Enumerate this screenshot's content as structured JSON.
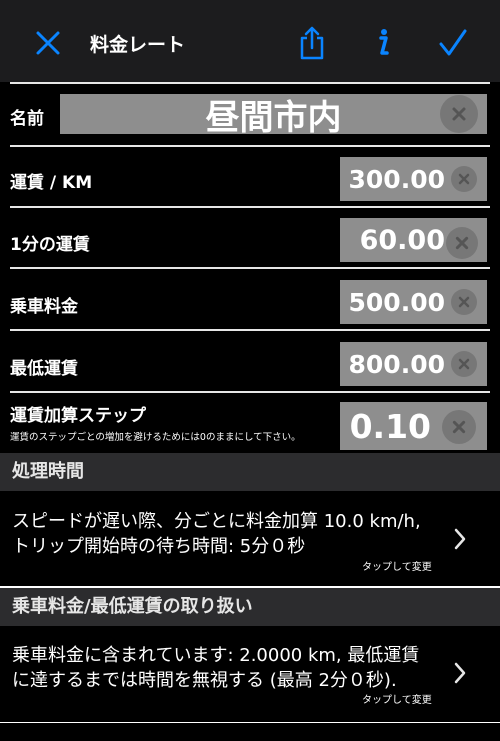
{
  "nav": {
    "title": "料金レート",
    "icons": [
      "close-icon",
      "share-icon",
      "info-icon",
      "checkmark-icon"
    ],
    "accent_color": "#0a84ff"
  },
  "form": {
    "name_label": "名前",
    "name_value": "昼間市内",
    "fare_per_km_label": "運賃 / KM",
    "fare_per_km_value": "300.00",
    "fare_per_min_label": "1分の運賃",
    "fare_per_min_value": "60.00",
    "boarding_fare_label": "乗車料金",
    "boarding_fare_value": "500.00",
    "min_fare_label": "最低運賃",
    "min_fare_value": "800.00",
    "fare_step_label": "運賃加算ステップ",
    "fare_step_note": "運賃のステップごとの増加を避けるためには0のままにして下さい。",
    "fare_step_value": "0.10"
  },
  "processing_time": {
    "header": "処理時間",
    "line1": "スピードが遅い際、分ごとに料金加算 10.0 km/h,",
    "line2": "トリップ開始時の待ち時間: 5分０秒",
    "tap_hint": "タップして変更"
  },
  "boarding_fare_handling": {
    "header": "乗車料金/最低運賃の取り扱い",
    "line1": "乗車料金に含まれています: 2.0000 km, 最低運賃",
    "line2": "に達するまでは時間を無視する (最高 2分０秒).",
    "tap_hint": "タップして変更"
  }
}
